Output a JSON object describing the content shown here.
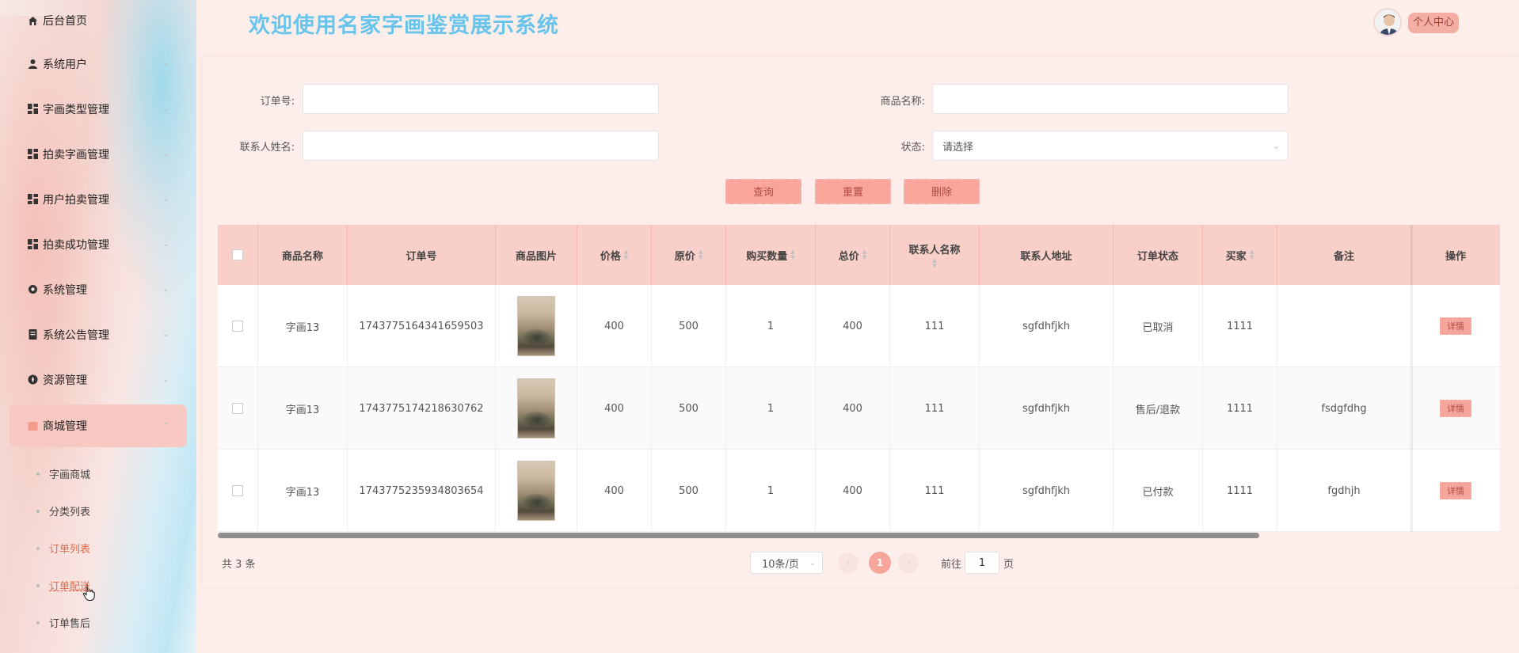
{
  "header": {
    "title": "欢迎使用名家字画鉴赏展示系统",
    "profile_label": "个人中心"
  },
  "sidebar": {
    "items": [
      {
        "label": "后台首页",
        "icon": "home-icon"
      },
      {
        "label": "系统用户",
        "icon": "user-icon"
      },
      {
        "label": "字画类型管理",
        "icon": "grid-icon"
      },
      {
        "label": "拍卖字画管理",
        "icon": "grid-icon"
      },
      {
        "label": "用户拍卖管理",
        "icon": "grid-icon"
      },
      {
        "label": "拍卖成功管理",
        "icon": "grid-icon"
      },
      {
        "label": "系统管理",
        "icon": "gear-icon"
      },
      {
        "label": "系统公告管理",
        "icon": "document-icon"
      },
      {
        "label": "资源管理",
        "icon": "resource-icon"
      },
      {
        "label": "商城管理",
        "icon": "shop-icon"
      }
    ],
    "sub_items": [
      {
        "label": "字画商城"
      },
      {
        "label": "分类列表"
      },
      {
        "label": "订单列表"
      },
      {
        "label": "订单配送"
      },
      {
        "label": "订单售后"
      }
    ]
  },
  "search": {
    "order_no_label": "订单号:",
    "product_name_label": "商品名称:",
    "contact_name_label": "联系人姓名:",
    "status_label": "状态:",
    "status_placeholder": "请选择",
    "query_label": "查询",
    "reset_label": "重置",
    "delete_label": "删除"
  },
  "table": {
    "columns": [
      "商品名称",
      "订单号",
      "商品图片",
      "价格",
      "原价",
      "购买数量",
      "总价",
      "联系人名称",
      "联系人地址",
      "订单状态",
      "买家",
      "备注",
      "操作"
    ],
    "rows": [
      {
        "name": "字画13",
        "order_no": "1743775164341659503",
        "price": "400",
        "original_price": "500",
        "qty": "1",
        "total": "400",
        "contact": "111",
        "address": "sgfdhfjkh",
        "status": "已取消",
        "buyer": "1111",
        "note": "",
        "action": "详情"
      },
      {
        "name": "字画13",
        "order_no": "1743775174218630762",
        "price": "400",
        "original_price": "500",
        "qty": "1",
        "total": "400",
        "contact": "111",
        "address": "sgfdhfjkh",
        "status": "售后/退款",
        "buyer": "1111",
        "note": "fsdgfdhg",
        "action": "详情"
      },
      {
        "name": "字画13",
        "order_no": "1743775235934803654",
        "price": "400",
        "original_price": "500",
        "qty": "1",
        "total": "400",
        "contact": "111",
        "address": "sgfdhfjkh",
        "status": "已付款",
        "buyer": "1111",
        "note": "fgdhjh",
        "action": "详情"
      }
    ]
  },
  "pagination": {
    "total_label": "共 3 条",
    "page_size": "10条/页",
    "current_page": "1",
    "goto_prefix": "前往",
    "goto_value": "1",
    "goto_suffix": "页"
  },
  "colors": {
    "accent": "#f6a59b",
    "title": "#69c4ec",
    "highlight_text": "#e06a4a"
  }
}
